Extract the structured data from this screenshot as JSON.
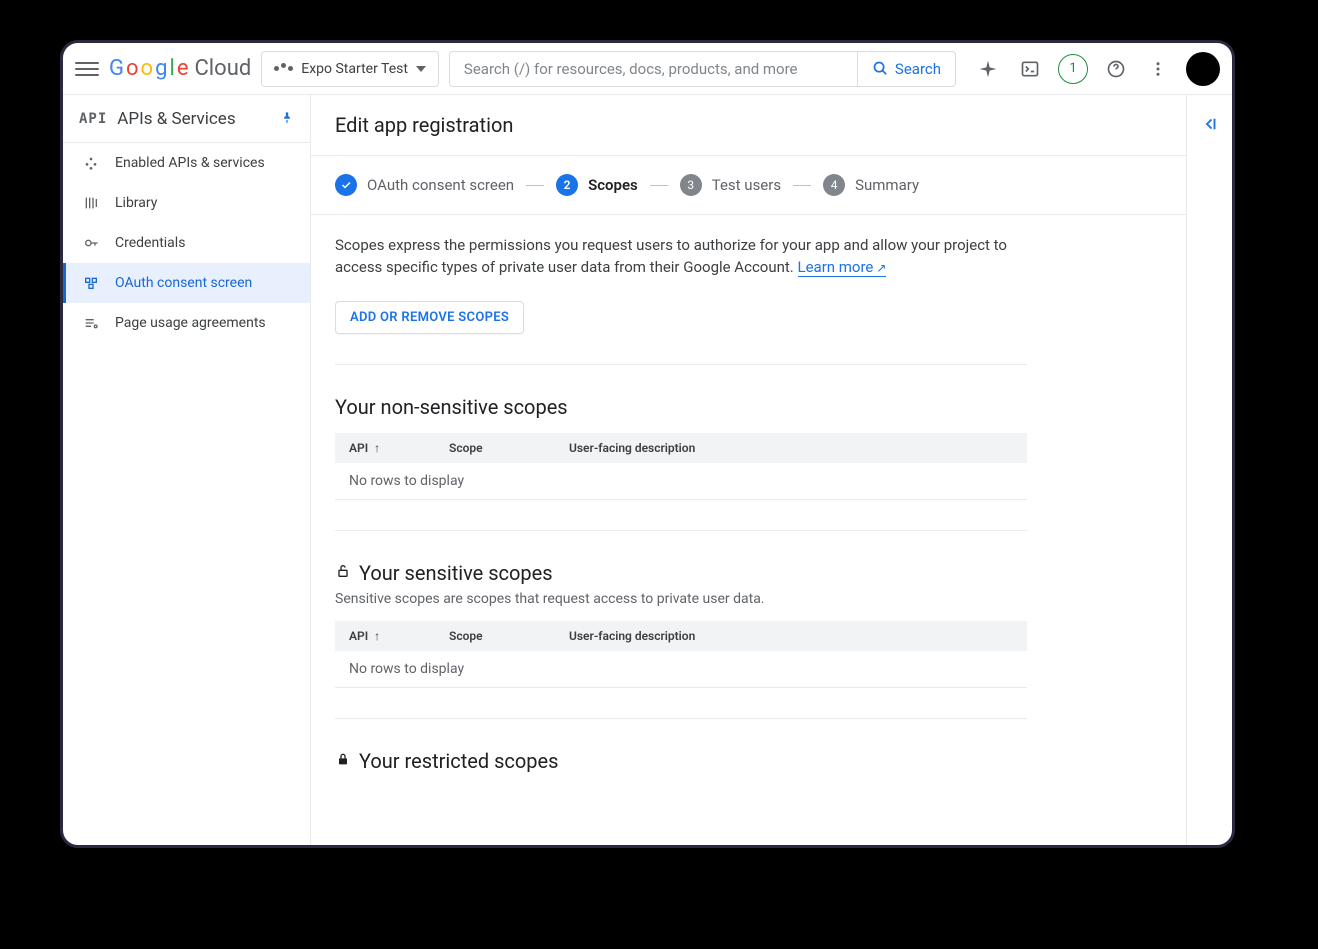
{
  "header": {
    "logo_cloud": "Cloud",
    "project_name": "Expo Starter Test",
    "search_placeholder": "Search (/) for resources, docs, products, and more",
    "search_button": "Search",
    "notification_count": "1"
  },
  "sidebar": {
    "product_badge": "API",
    "product_title": "APIs & Services",
    "items": [
      {
        "label": "Enabled APIs & services"
      },
      {
        "label": "Library"
      },
      {
        "label": "Credentials"
      },
      {
        "label": "OAuth consent screen"
      },
      {
        "label": "Page usage agreements"
      }
    ]
  },
  "page": {
    "title": "Edit app registration",
    "stepper": [
      {
        "label": "OAuth consent screen"
      },
      {
        "label": "Scopes",
        "num": "2"
      },
      {
        "label": "Test users",
        "num": "3"
      },
      {
        "label": "Summary",
        "num": "4"
      }
    ],
    "description": "Scopes express the permissions you request users to authorize for your app and allow your project to access specific types of private user data from their Google Account. ",
    "learn_more": "Learn more",
    "add_remove_button": "ADD OR REMOVE SCOPES",
    "table_headers": {
      "api": "API",
      "scope": "Scope",
      "desc": "User-facing description"
    },
    "no_rows": "No rows to display",
    "sections": {
      "non_sensitive": {
        "title": "Your non-sensitive scopes"
      },
      "sensitive": {
        "title": "Your sensitive scopes",
        "subtitle": "Sensitive scopes are scopes that request access to private user data."
      },
      "restricted": {
        "title": "Your restricted scopes"
      }
    }
  }
}
